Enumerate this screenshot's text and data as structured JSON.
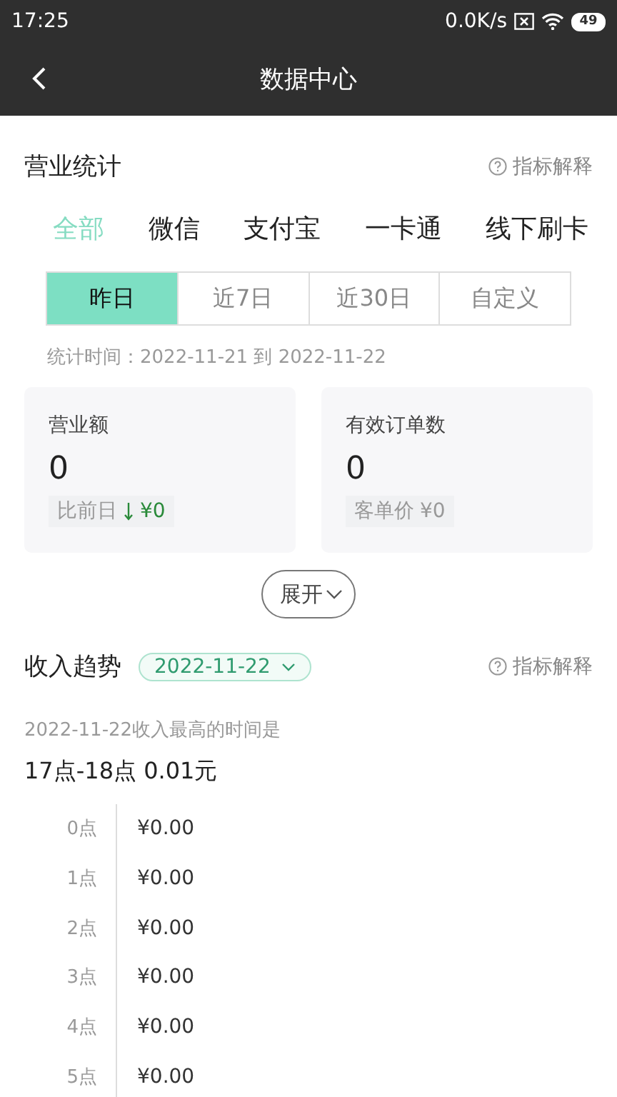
{
  "status_bar": {
    "time": "17:25",
    "net_speed": "0.0K/s",
    "battery": "49"
  },
  "header": {
    "title": "数据中心"
  },
  "business_stats": {
    "title": "营业统计",
    "help": "指标解释",
    "channel_tabs": [
      {
        "label": "全部",
        "selected": true
      },
      {
        "label": "微信",
        "selected": false
      },
      {
        "label": "支付宝",
        "selected": false
      },
      {
        "label": "一卡通",
        "selected": false
      },
      {
        "label": "线下刷卡",
        "selected": false
      }
    ],
    "period_tabs": [
      {
        "label": "昨日",
        "selected": true
      },
      {
        "label": "近7日",
        "selected": false
      },
      {
        "label": "近30日",
        "selected": false
      },
      {
        "label": "自定义",
        "selected": false
      }
    ],
    "period_text": "统计时间：2022-11-21 到 2022-11-22",
    "cards": [
      {
        "label": "营业额",
        "value": "0",
        "note_label": "比前日",
        "decreased": true,
        "note_value": "¥0"
      },
      {
        "label": "有效订单数",
        "value": "0",
        "note_label": "客单价",
        "decreased": false,
        "note_value": "¥0"
      }
    ],
    "expand_button": "展开"
  },
  "income_trend": {
    "title": "收入趋势",
    "date": "2022-11-22",
    "help": "指标解释",
    "peak_caption": "2022-11-22收入最高的时间是",
    "peak_value": "17点-18点 0.01元",
    "hours": [
      {
        "hour": "0点",
        "amount": "¥0.00"
      },
      {
        "hour": "1点",
        "amount": "¥0.00"
      },
      {
        "hour": "2点",
        "amount": "¥0.00"
      },
      {
        "hour": "3点",
        "amount": "¥0.00"
      },
      {
        "hour": "4点",
        "amount": "¥0.00"
      },
      {
        "hour": "5点",
        "amount": "¥0.00"
      }
    ]
  }
}
